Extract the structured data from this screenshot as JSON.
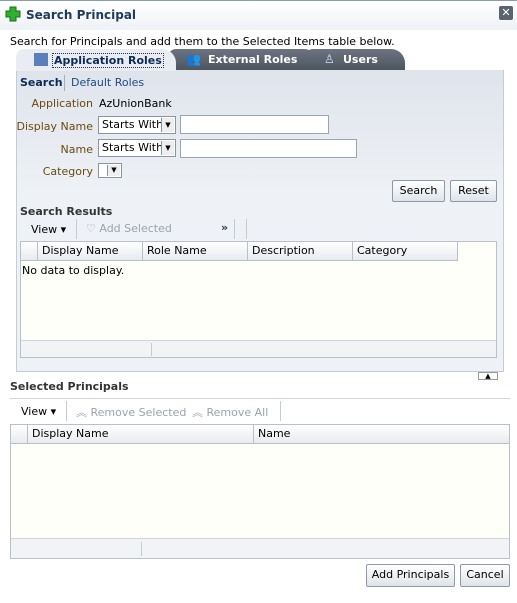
{
  "dialog": {
    "title": "Search Principal",
    "icon": "green-plus-icon",
    "close_icon": "close-icon",
    "close_glyph": "✕"
  },
  "intro": "Search for Principals and add them to the Selected Items table below.",
  "tabs": [
    {
      "label": "Application Roles",
      "active": true
    },
    {
      "label": "External Roles"
    },
    {
      "label": "Users"
    }
  ],
  "subnav": {
    "search": "Search",
    "default_roles": "Default Roles"
  },
  "form": {
    "application_label": "Application",
    "application_value": "AzUnionBank",
    "display_name_label": "Display Name",
    "display_name_operator": "Starts With",
    "display_name_value": "",
    "name_label": "Name",
    "name_operator": "Starts With",
    "name_value": "",
    "category_label": "Category",
    "category_value": ""
  },
  "buttons": {
    "search": "Search",
    "reset": "Reset",
    "add_principals": "Add Principals",
    "cancel": "Cancel"
  },
  "search_results": {
    "title": "Search Results",
    "view": "View",
    "add_selected": "Add Selected",
    "more": "»",
    "columns": [
      "Display Name",
      "Role Name",
      "Description",
      "Category"
    ],
    "empty": "No data to display."
  },
  "selected": {
    "title": "Selected Principals",
    "view": "View",
    "remove_selected": "Remove Selected",
    "remove_all": "Remove All",
    "columns": [
      "Display Name",
      "Name"
    ]
  },
  "colors": {
    "title": "#1f3a5a",
    "accent": "#0b2a55"
  }
}
